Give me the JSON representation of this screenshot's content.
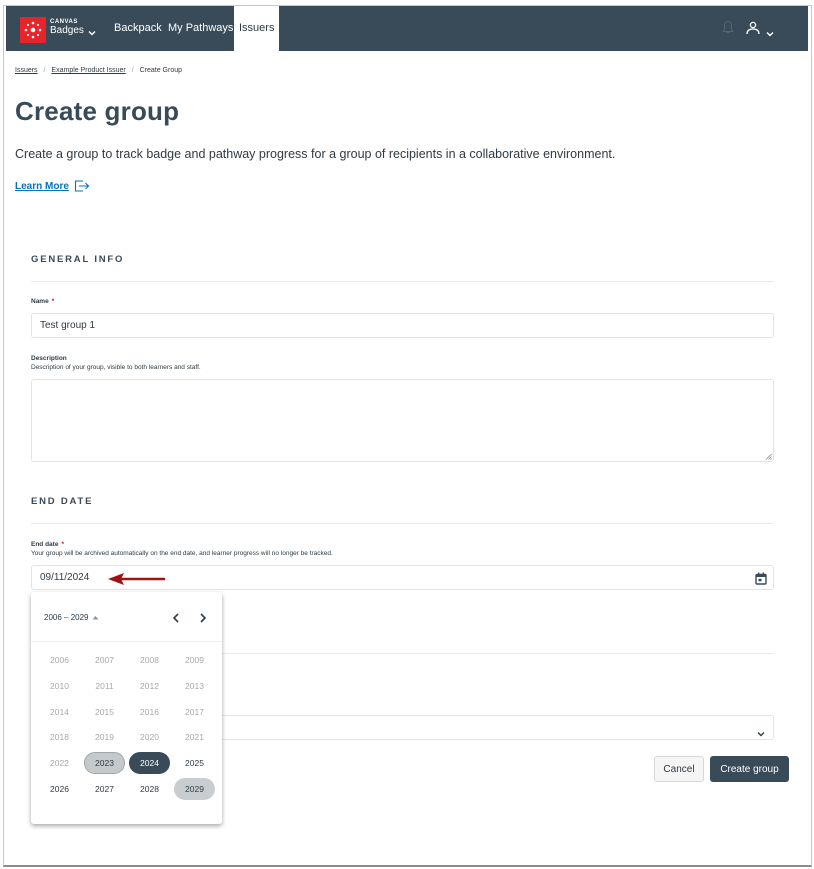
{
  "nav": {
    "brand_small": "CANVAS",
    "brand_big": "Badges",
    "links": [
      "Backpack",
      "My Pathways",
      "Issuers"
    ],
    "active": "Issuers",
    "icons": {
      "logo": "canvas-logo-icon",
      "bell": "bell-icon",
      "user": "user-icon",
      "chevron": "chevron-down-icon"
    }
  },
  "breadcrumb": {
    "items": [
      "Issuers",
      "Example Product Issuer",
      "Create Group"
    ],
    "separator": "/"
  },
  "page": {
    "title": "Create group",
    "subtitle": "Create a group to track badge and pathway progress for a group of recipients in a collaborative environment.",
    "learn_more": "Learn More"
  },
  "general_info": {
    "heading": "GENERAL INFO",
    "name_label": "Name",
    "required_mark": "*",
    "name_value": "Test group 1",
    "description_label": "Description",
    "description_help": "Description of your group, visible to both learners and staff.",
    "description_value": ""
  },
  "end_date": {
    "heading": "END DATE",
    "label": "End date",
    "required_mark": "*",
    "help": "Your group will be archived automatically on the end date, and learner progress will no longer be tracked.",
    "value": "09/11/2024"
  },
  "annotation": {
    "arrow_color": "#a01212"
  },
  "date_picker": {
    "range_label": "2006 – 2029",
    "years": [
      {
        "y": "2006",
        "state": "disabled"
      },
      {
        "y": "2007",
        "state": "disabled"
      },
      {
        "y": "2008",
        "state": "disabled"
      },
      {
        "y": "2009",
        "state": "disabled"
      },
      {
        "y": "2010",
        "state": "disabled"
      },
      {
        "y": "2011",
        "state": "disabled"
      },
      {
        "y": "2012",
        "state": "disabled"
      },
      {
        "y": "2013",
        "state": "disabled"
      },
      {
        "y": "2014",
        "state": "disabled"
      },
      {
        "y": "2015",
        "state": "disabled"
      },
      {
        "y": "2016",
        "state": "disabled"
      },
      {
        "y": "2017",
        "state": "disabled"
      },
      {
        "y": "2018",
        "state": "disabled"
      },
      {
        "y": "2019",
        "state": "disabled"
      },
      {
        "y": "2020",
        "state": "disabled"
      },
      {
        "y": "2021",
        "state": "disabled"
      },
      {
        "y": "2022",
        "state": "disabled"
      },
      {
        "y": "2023",
        "state": "current"
      },
      {
        "y": "2024",
        "state": "selected"
      },
      {
        "y": "2025",
        "state": "normal"
      },
      {
        "y": "2026",
        "state": "normal"
      },
      {
        "y": "2027",
        "state": "normal"
      },
      {
        "y": "2028",
        "state": "normal"
      },
      {
        "y": "2029",
        "state": "hover"
      }
    ]
  },
  "buttons": {
    "cancel": "Cancel",
    "create": "Create group"
  },
  "colors": {
    "nav_bg": "#394b58",
    "brand_red": "#e72429",
    "link_blue": "#0374b5",
    "required_red": "#e0061f",
    "primary_button": "#394b58"
  }
}
